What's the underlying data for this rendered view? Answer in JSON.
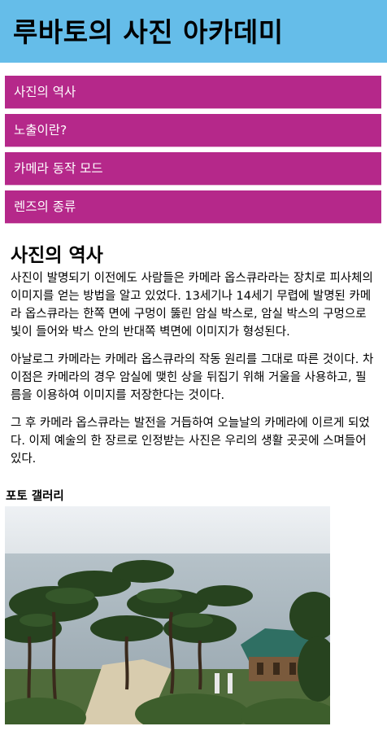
{
  "header": {
    "title": "루바토의 사진 아카데미"
  },
  "nav": {
    "items": [
      {
        "label": "사진의 역사"
      },
      {
        "label": "노출이란?"
      },
      {
        "label": "카메라 동작 모드"
      },
      {
        "label": "렌즈의 종류"
      }
    ]
  },
  "article": {
    "title": "사진의 역사",
    "paragraphs": [
      "사진이 발명되기 이전에도 사람들은 카메라 옵스큐라라는 장치로 피사체의 이미지를 얻는 방법을 알고 있었다. 13세기나 14세기 무렵에 발명된 카메라 옵스큐라는 한쪽 면에 구멍이 뚫린 암실 박스로, 암실 박스의 구멍으로 빛이 들어와 박스 안의 반대쪽 벽면에 이미지가 형성된다.",
      "아날로그 카메라는 카메라 옵스큐라의 작동 원리를 그대로 따른 것이다. 차이점은 카메라의 경우 암실에 맺힌 상을 뒤집기 위해 거울을 사용하고, 필름을 이용하여 이미지를 저장한다는 것이다.",
      "그 후 카메라 옵스큐라는 발전을 거듭하여 오늘날의 카메라에 이르게 되었다. 이제 예술의 한 장르로 인정받는 사진은 우리의 생활 곳곳에 스며들어 있다."
    ]
  },
  "gallery": {
    "title": "포토 갤러리"
  }
}
